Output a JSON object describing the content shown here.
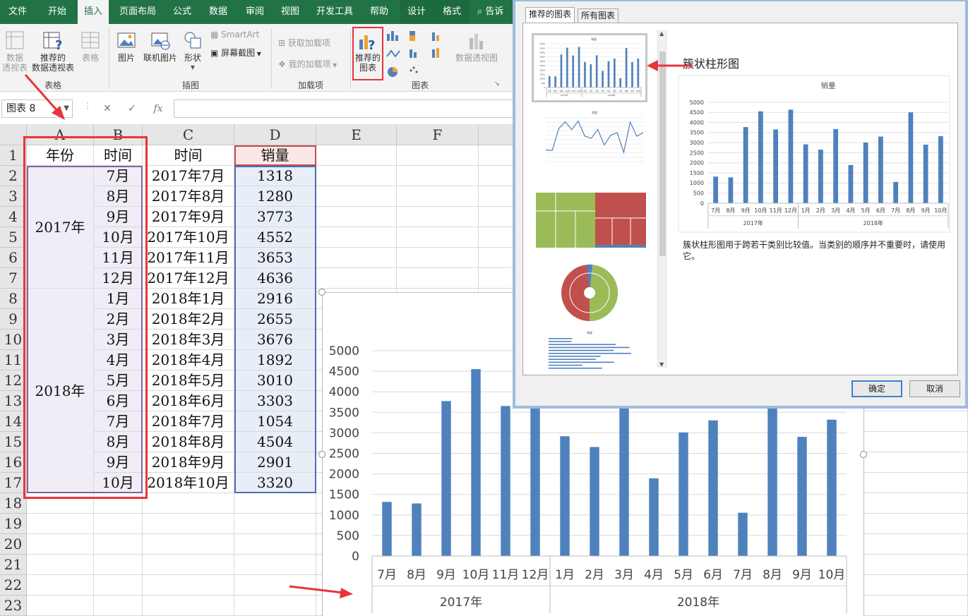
{
  "ribbon_tabs": [
    {
      "label": "文件"
    },
    {
      "label": "开始"
    },
    {
      "label": "插入",
      "active": true
    },
    {
      "label": "页面布局"
    },
    {
      "label": "公式"
    },
    {
      "label": "数据"
    },
    {
      "label": "审阅"
    },
    {
      "label": "视图"
    },
    {
      "label": "开发工具"
    },
    {
      "label": "帮助"
    },
    {
      "label": "设计"
    },
    {
      "label": "格式"
    },
    {
      "label": "告诉"
    }
  ],
  "ribbon": {
    "pivot": {
      "line1": "数据",
      "line2": "透视表"
    },
    "recommended_pivot": {
      "line1": "推荐的",
      "line2": "数据透视表"
    },
    "table": "表格",
    "group_table": "表格",
    "picture": "图片",
    "online_picture": "联机图片",
    "shapes": "形状",
    "smartart": "SmartArt",
    "screenshot": "屏幕截图",
    "group_illustrations": "插图",
    "get_addins": "获取加载项",
    "my_addins": "我的加载项",
    "group_addins": "加载项",
    "recommended_charts": {
      "line1": "推荐的",
      "line2": "图表"
    },
    "group_charts": "图表",
    "pivot_chart": "数据透视图"
  },
  "formula_bar": {
    "name_box": "图表 8",
    "fx": "fx",
    "cancel": "✕",
    "enter": "✓"
  },
  "sheet": {
    "columns": [
      "A",
      "B",
      "C",
      "D",
      "E",
      "F"
    ],
    "rows": [
      "1",
      "2",
      "3",
      "4",
      "5",
      "6",
      "7",
      "8",
      "9",
      "10",
      "11",
      "12",
      "13",
      "14",
      "15",
      "16",
      "17",
      "18",
      "19",
      "20",
      "21",
      "22",
      "23"
    ],
    "header": {
      "a": "年份",
      "b": "时间",
      "c": "时间",
      "d": "销量"
    },
    "year_2017": "2017年",
    "year_2018": "2018年",
    "data_rows": [
      {
        "b": "7月",
        "c": "2017年7月",
        "d": "1318"
      },
      {
        "b": "8月",
        "c": "2017年8月",
        "d": "1280"
      },
      {
        "b": "9月",
        "c": "2017年9月",
        "d": "3773"
      },
      {
        "b": "10月",
        "c": "2017年10月",
        "d": "4552"
      },
      {
        "b": "11月",
        "c": "2017年11月",
        "d": "3653"
      },
      {
        "b": "12月",
        "c": "2017年12月",
        "d": "4636"
      },
      {
        "b": "1月",
        "c": "2018年1月",
        "d": "2916"
      },
      {
        "b": "2月",
        "c": "2018年2月",
        "d": "2655"
      },
      {
        "b": "3月",
        "c": "2018年3月",
        "d": "3676"
      },
      {
        "b": "4月",
        "c": "2018年4月",
        "d": "1892"
      },
      {
        "b": "5月",
        "c": "2018年5月",
        "d": "3010"
      },
      {
        "b": "6月",
        "c": "2018年6月",
        "d": "3303"
      },
      {
        "b": "7月",
        "c": "2018年7月",
        "d": "1054"
      },
      {
        "b": "8月",
        "c": "2018年8月",
        "d": "4504"
      },
      {
        "b": "9月",
        "c": "2018年9月",
        "d": "2901"
      },
      {
        "b": "10月",
        "c": "2018年10月",
        "d": "3320"
      }
    ]
  },
  "chart_data": {
    "type": "bar",
    "title": "销量",
    "categories": [
      "7月",
      "8月",
      "9月",
      "10月",
      "11月",
      "12月",
      "1月",
      "2月",
      "3月",
      "4月",
      "5月",
      "6月",
      "7月",
      "8月",
      "9月",
      "10月"
    ],
    "groups": [
      {
        "label": "2017年",
        "count": 6
      },
      {
        "label": "2018年",
        "count": 10
      }
    ],
    "values": [
      1318,
      1280,
      3773,
      4552,
      3653,
      4636,
      2916,
      2655,
      3676,
      1892,
      3010,
      3303,
      1054,
      4504,
      2901,
      3320
    ],
    "yticks": [
      0,
      500,
      1000,
      1500,
      2000,
      2500,
      3000,
      3500,
      4000,
      4500,
      5000
    ],
    "ylim": [
      0,
      5000
    ],
    "color": "#4f81bd"
  },
  "dialog": {
    "tab_recommended": "推荐的图表",
    "tab_all": "所有图表",
    "chart_type_title": "簇状柱形图",
    "preview_title": "销量",
    "description": "簇状柱形图用于跨若干类别比较值。当类别的顺序并不重要时，请使用它。",
    "ok": "确定",
    "cancel": "取消"
  }
}
